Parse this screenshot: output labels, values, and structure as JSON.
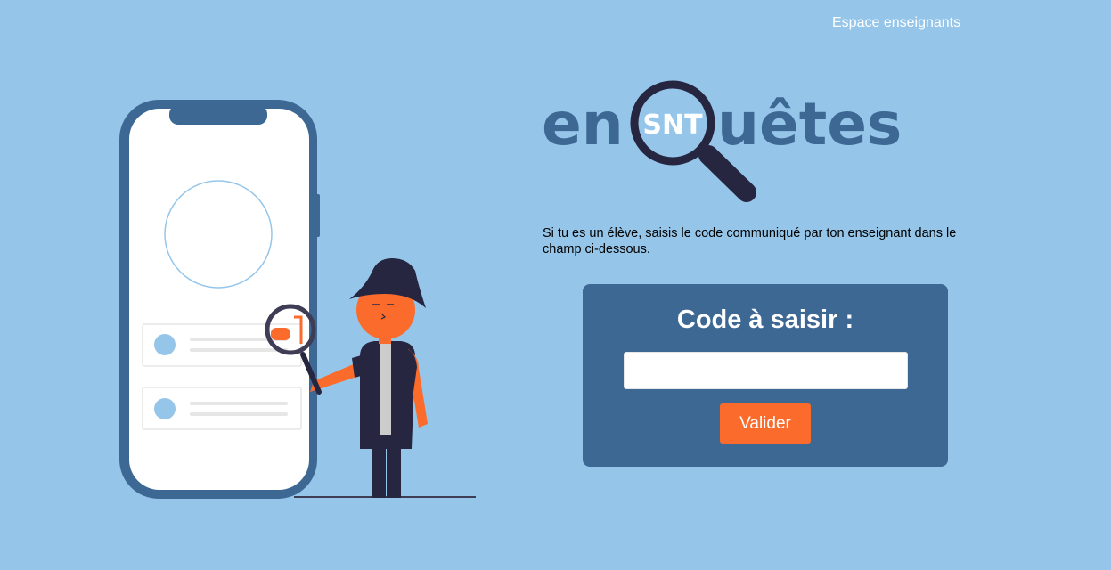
{
  "header": {
    "teacher_link": "Espace enseignants"
  },
  "logo": {
    "text_left": "en",
    "badge": "SNT",
    "text_right": "uêtes"
  },
  "instructions": {
    "text": "Si tu es un élève, saisis le code communiqué par ton enseignant dans le champ ci-dessous."
  },
  "code_form": {
    "title": "Code à saisir :",
    "input_value": "",
    "submit_label": "Valider"
  },
  "colors": {
    "background": "#95c6ea",
    "panel": "#3d6894",
    "accent": "#fb6b2c",
    "logo_text": "#3d6894",
    "dark": "#262640"
  },
  "icons": {
    "illustration": "detective-with-magnifier-and-phone",
    "logo_icon": "magnifying-glass-icon"
  }
}
